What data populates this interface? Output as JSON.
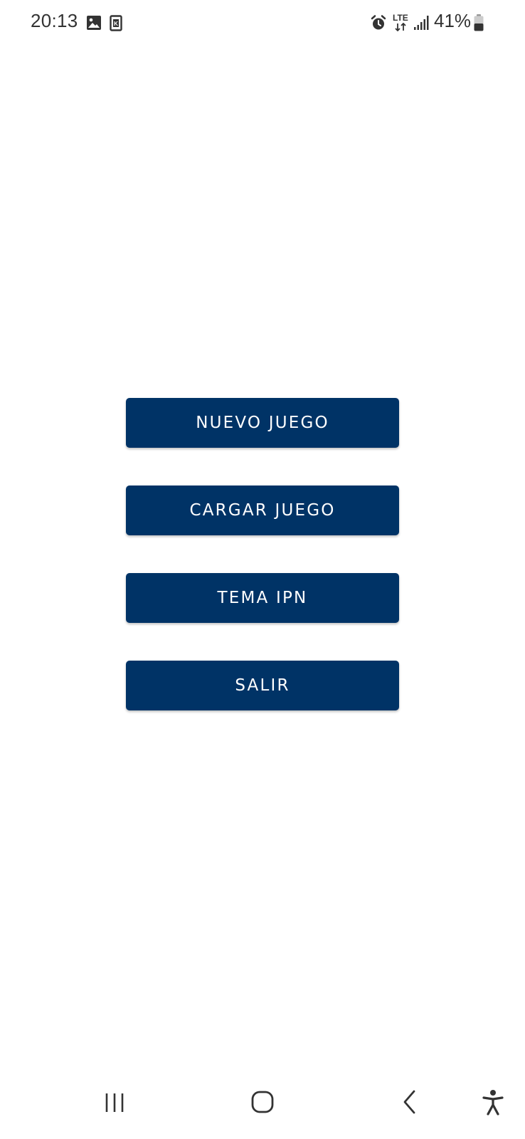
{
  "status_bar": {
    "time": "20:13",
    "battery": "41%",
    "left_icons": [
      "gallery-icon",
      "sim-card-icon"
    ],
    "right_icons": [
      "alarm-icon",
      "lte-icon",
      "signal-icon",
      "battery-icon"
    ],
    "network": "LTE"
  },
  "menu": {
    "buttons": [
      {
        "label": "NUEVO JUEGO"
      },
      {
        "label": "CARGAR JUEGO"
      },
      {
        "label": "TEMA IPN"
      },
      {
        "label": "SALIR"
      }
    ]
  },
  "nav_bar": {
    "icons": [
      "recent-apps-icon",
      "home-icon",
      "back-icon",
      "accessibility-icon"
    ]
  },
  "colors": {
    "button_bg": "#003366",
    "button_text": "#ffffff",
    "background": "#ffffff",
    "status_text": "#333333",
    "nav_icon": "#333333"
  }
}
